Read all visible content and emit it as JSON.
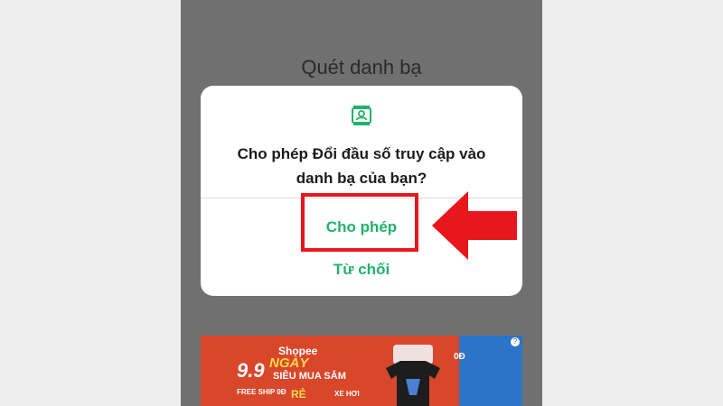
{
  "screen": {
    "title": "Quét danh bạ"
  },
  "dialog": {
    "icon": "contacts-icon",
    "message": "Cho phép Đổi đầu số truy cập vào danh bạ của bạn?",
    "allow_label": "Cho phép",
    "deny_label": "Từ chối",
    "accent_color": "#20b26b"
  },
  "annotation": {
    "highlight_color": "#e8161d",
    "arrow": "red-arrow-left"
  },
  "banner": {
    "brand": "Shopee",
    "date": "9.9",
    "headline": "NGÀY",
    "subline": "SIÊU MUA SẮM",
    "tag_free": "FREE SHIP 0Đ",
    "tag_cheap": "RẺ",
    "tag_prize": "XE HƠI",
    "tag_price": "0Đ",
    "help": "?"
  }
}
